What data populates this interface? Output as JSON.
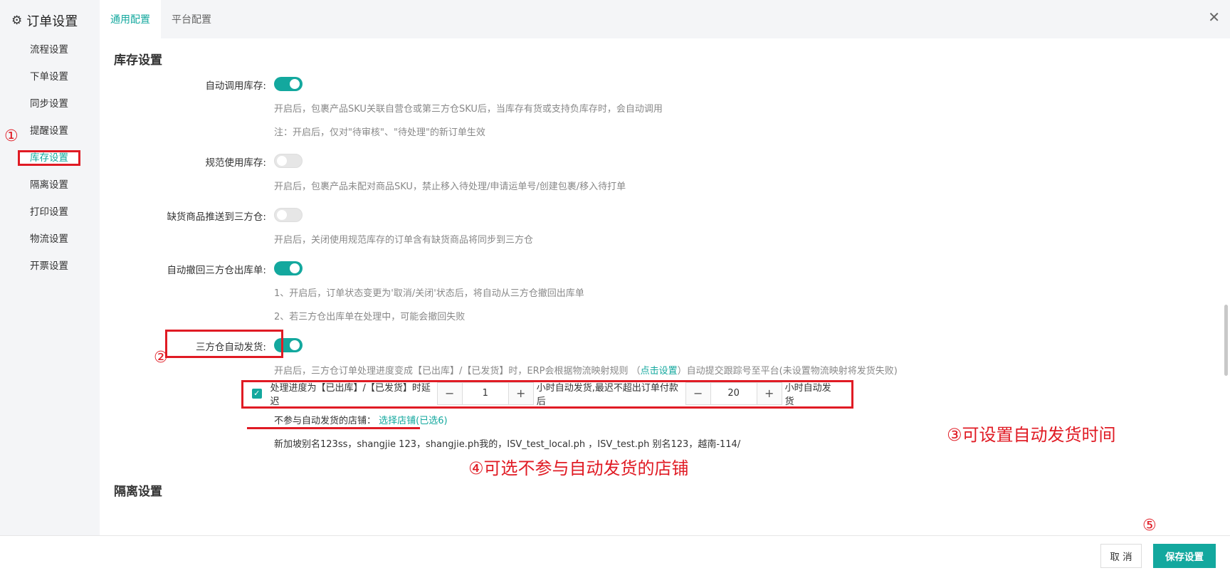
{
  "window": {
    "title": "订单设置",
    "close_icon": "close-icon"
  },
  "tabs": [
    {
      "label": "通用配置",
      "active": true
    },
    {
      "label": "平台配置",
      "active": false
    }
  ],
  "sidebar": {
    "items": [
      {
        "label": "流程设置"
      },
      {
        "label": "下单设置"
      },
      {
        "label": "同步设置"
      },
      {
        "label": "提醒设置"
      },
      {
        "label": "库存设置",
        "active": true
      },
      {
        "label": "隔离设置"
      },
      {
        "label": "打印设置"
      },
      {
        "label": "物流设置"
      },
      {
        "label": "开票设置"
      }
    ]
  },
  "section": {
    "title": "库存设置",
    "next_title": "隔离设置",
    "rows": [
      {
        "label": "自动调用库存:",
        "on": true,
        "hints": [
          "开启后，包裹产品SKU关联自营仓或第三方仓SKU后，当库存有货或支持负库存时，会自动调用",
          "注：开启后，仅对\"待审核\"、\"待处理\"的新订单生效"
        ]
      },
      {
        "label": "规范使用库存:",
        "on": false,
        "hints": [
          "开启后，包裹产品未配对商品SKU，禁止移入待处理/申请运单号/创建包裹/移入待打单"
        ]
      },
      {
        "label": "缺货商品推送到三方仓:",
        "on": false,
        "hints": [
          "开启后，关闭使用规范库存的订单含有缺货商品将同步到三方仓"
        ]
      },
      {
        "label": "自动撤回三方仓出库单:",
        "on": true,
        "hints": [
          "1、开启后，订单状态变更为'取消/关闭'状态后，将自动从三方仓撤回出库单",
          "2、若三方仓出库单在处理中，可能会撤回失败"
        ]
      },
      {
        "label": "三方仓自动发货:",
        "on": true,
        "hint_before": "开启后，三方仓订单处理进度变成【已出库】/【已发货】时，ERP会根据物流映射规则 （",
        "hint_link": "点击设置",
        "hint_after": "）自动提交跟踪号至平台(未设置物流映射将发货失败)"
      }
    ],
    "delay": {
      "checked": true,
      "text1": "处理进度为【已出库】/【已发货】时延迟",
      "value1": "1",
      "text2": "小时自动发货,最迟不超出订单付款后",
      "value2": "20",
      "text3": "小时自动发货"
    },
    "exclude": {
      "label": "不参与自动发货的店铺：",
      "link": "选择店铺(已选6)",
      "stores": "新加坡别名123ss，shangjie 123，shangjie.ph我的，ISV_test_local.ph ，ISV_test.ph 别名123，越南-114/"
    }
  },
  "annotations": {
    "n1": "①",
    "n2": "②",
    "n3": "③可设置自动发货时间",
    "n4": "④可选不参与自动发货的店铺",
    "n5": "⑤"
  },
  "footer": {
    "cancel": "取 消",
    "save": "保存设置"
  },
  "colors": {
    "accent": "#13a89e",
    "annotation": "#e01b24"
  }
}
